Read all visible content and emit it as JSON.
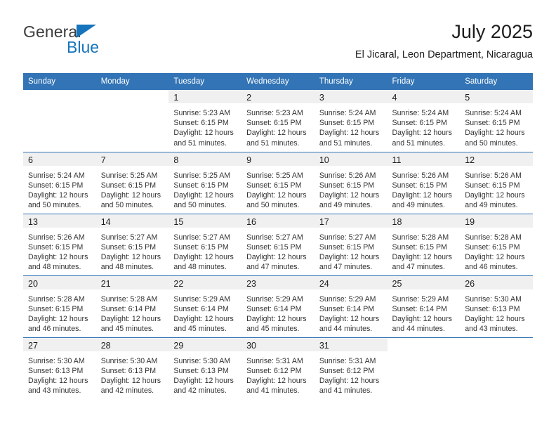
{
  "brand": {
    "name_top": "General",
    "name_bottom": "Blue",
    "triangle_color": "#1574bc",
    "top_text_color": "#3c3c3c"
  },
  "header": {
    "title": "July 2025",
    "subtitle": "El Jicaral, Leon Department, Nicaragua"
  },
  "theme": {
    "header_blue": "#3274b5",
    "day_band_gray": "#f0f0f0",
    "text_color": "#333333"
  },
  "calendar": {
    "weekday_headers": [
      "Sunday",
      "Monday",
      "Tuesday",
      "Wednesday",
      "Thursday",
      "Friday",
      "Saturday"
    ],
    "weeks": [
      [
        {
          "empty": true
        },
        {
          "empty": true
        },
        {
          "day": "1",
          "sunrise": "Sunrise: 5:23 AM",
          "sunset": "Sunset: 6:15 PM",
          "daylight": "Daylight: 12 hours and 51 minutes."
        },
        {
          "day": "2",
          "sunrise": "Sunrise: 5:23 AM",
          "sunset": "Sunset: 6:15 PM",
          "daylight": "Daylight: 12 hours and 51 minutes."
        },
        {
          "day": "3",
          "sunrise": "Sunrise: 5:24 AM",
          "sunset": "Sunset: 6:15 PM",
          "daylight": "Daylight: 12 hours and 51 minutes."
        },
        {
          "day": "4",
          "sunrise": "Sunrise: 5:24 AM",
          "sunset": "Sunset: 6:15 PM",
          "daylight": "Daylight: 12 hours and 51 minutes."
        },
        {
          "day": "5",
          "sunrise": "Sunrise: 5:24 AM",
          "sunset": "Sunset: 6:15 PM",
          "daylight": "Daylight: 12 hours and 50 minutes."
        }
      ],
      [
        {
          "day": "6",
          "sunrise": "Sunrise: 5:24 AM",
          "sunset": "Sunset: 6:15 PM",
          "daylight": "Daylight: 12 hours and 50 minutes."
        },
        {
          "day": "7",
          "sunrise": "Sunrise: 5:25 AM",
          "sunset": "Sunset: 6:15 PM",
          "daylight": "Daylight: 12 hours and 50 minutes."
        },
        {
          "day": "8",
          "sunrise": "Sunrise: 5:25 AM",
          "sunset": "Sunset: 6:15 PM",
          "daylight": "Daylight: 12 hours and 50 minutes."
        },
        {
          "day": "9",
          "sunrise": "Sunrise: 5:25 AM",
          "sunset": "Sunset: 6:15 PM",
          "daylight": "Daylight: 12 hours and 50 minutes."
        },
        {
          "day": "10",
          "sunrise": "Sunrise: 5:26 AM",
          "sunset": "Sunset: 6:15 PM",
          "daylight": "Daylight: 12 hours and 49 minutes."
        },
        {
          "day": "11",
          "sunrise": "Sunrise: 5:26 AM",
          "sunset": "Sunset: 6:15 PM",
          "daylight": "Daylight: 12 hours and 49 minutes."
        },
        {
          "day": "12",
          "sunrise": "Sunrise: 5:26 AM",
          "sunset": "Sunset: 6:15 PM",
          "daylight": "Daylight: 12 hours and 49 minutes."
        }
      ],
      [
        {
          "day": "13",
          "sunrise": "Sunrise: 5:26 AM",
          "sunset": "Sunset: 6:15 PM",
          "daylight": "Daylight: 12 hours and 48 minutes."
        },
        {
          "day": "14",
          "sunrise": "Sunrise: 5:27 AM",
          "sunset": "Sunset: 6:15 PM",
          "daylight": "Daylight: 12 hours and 48 minutes."
        },
        {
          "day": "15",
          "sunrise": "Sunrise: 5:27 AM",
          "sunset": "Sunset: 6:15 PM",
          "daylight": "Daylight: 12 hours and 48 minutes."
        },
        {
          "day": "16",
          "sunrise": "Sunrise: 5:27 AM",
          "sunset": "Sunset: 6:15 PM",
          "daylight": "Daylight: 12 hours and 47 minutes."
        },
        {
          "day": "17",
          "sunrise": "Sunrise: 5:27 AM",
          "sunset": "Sunset: 6:15 PM",
          "daylight": "Daylight: 12 hours and 47 minutes."
        },
        {
          "day": "18",
          "sunrise": "Sunrise: 5:28 AM",
          "sunset": "Sunset: 6:15 PM",
          "daylight": "Daylight: 12 hours and 47 minutes."
        },
        {
          "day": "19",
          "sunrise": "Sunrise: 5:28 AM",
          "sunset": "Sunset: 6:15 PM",
          "daylight": "Daylight: 12 hours and 46 minutes."
        }
      ],
      [
        {
          "day": "20",
          "sunrise": "Sunrise: 5:28 AM",
          "sunset": "Sunset: 6:15 PM",
          "daylight": "Daylight: 12 hours and 46 minutes."
        },
        {
          "day": "21",
          "sunrise": "Sunrise: 5:28 AM",
          "sunset": "Sunset: 6:14 PM",
          "daylight": "Daylight: 12 hours and 45 minutes."
        },
        {
          "day": "22",
          "sunrise": "Sunrise: 5:29 AM",
          "sunset": "Sunset: 6:14 PM",
          "daylight": "Daylight: 12 hours and 45 minutes."
        },
        {
          "day": "23",
          "sunrise": "Sunrise: 5:29 AM",
          "sunset": "Sunset: 6:14 PM",
          "daylight": "Daylight: 12 hours and 45 minutes."
        },
        {
          "day": "24",
          "sunrise": "Sunrise: 5:29 AM",
          "sunset": "Sunset: 6:14 PM",
          "daylight": "Daylight: 12 hours and 44 minutes."
        },
        {
          "day": "25",
          "sunrise": "Sunrise: 5:29 AM",
          "sunset": "Sunset: 6:14 PM",
          "daylight": "Daylight: 12 hours and 44 minutes."
        },
        {
          "day": "26",
          "sunrise": "Sunrise: 5:30 AM",
          "sunset": "Sunset: 6:13 PM",
          "daylight": "Daylight: 12 hours and 43 minutes."
        }
      ],
      [
        {
          "day": "27",
          "sunrise": "Sunrise: 5:30 AM",
          "sunset": "Sunset: 6:13 PM",
          "daylight": "Daylight: 12 hours and 43 minutes."
        },
        {
          "day": "28",
          "sunrise": "Sunrise: 5:30 AM",
          "sunset": "Sunset: 6:13 PM",
          "daylight": "Daylight: 12 hours and 42 minutes."
        },
        {
          "day": "29",
          "sunrise": "Sunrise: 5:30 AM",
          "sunset": "Sunset: 6:13 PM",
          "daylight": "Daylight: 12 hours and 42 minutes."
        },
        {
          "day": "30",
          "sunrise": "Sunrise: 5:31 AM",
          "sunset": "Sunset: 6:12 PM",
          "daylight": "Daylight: 12 hours and 41 minutes."
        },
        {
          "day": "31",
          "sunrise": "Sunrise: 5:31 AM",
          "sunset": "Sunset: 6:12 PM",
          "daylight": "Daylight: 12 hours and 41 minutes."
        },
        {
          "empty": true
        },
        {
          "empty": true
        }
      ]
    ]
  }
}
